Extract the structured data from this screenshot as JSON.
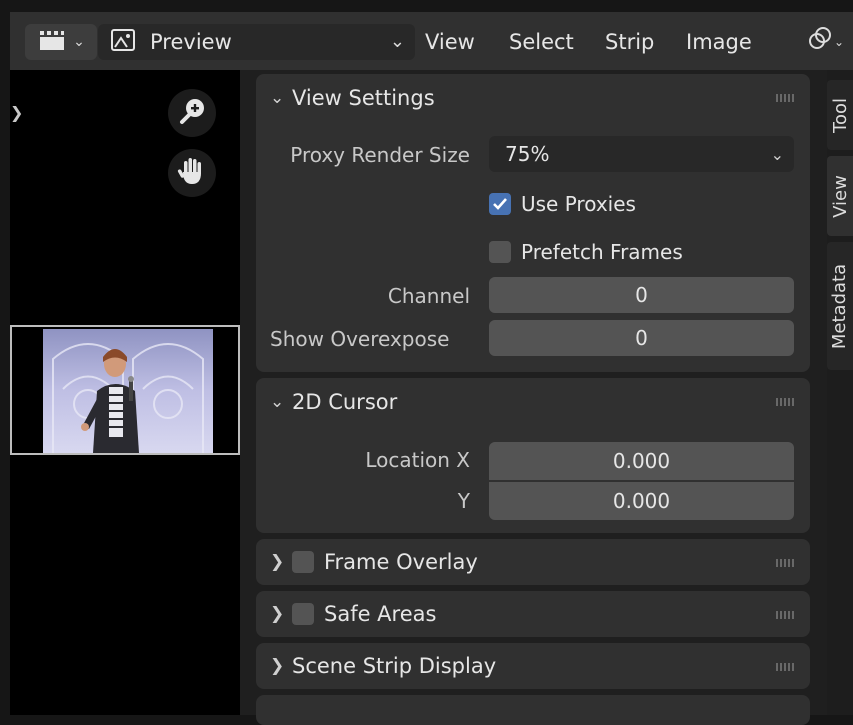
{
  "header": {
    "editor_type_icon": "sequencer-clapper-icon",
    "mode_icon": "image-preview-icon",
    "mode_label": "Preview",
    "menus": [
      "View",
      "Select",
      "Strip",
      "Image"
    ],
    "gizmo_icon": "link-icon"
  },
  "preview": {
    "zoom_icon": "zoom-in-icon",
    "pan_icon": "hand-pan-icon"
  },
  "view_settings": {
    "title": "View Settings",
    "proxy_render_size_label": "Proxy Render Size",
    "proxy_render_size_value": "75%",
    "use_proxies_label": "Use Proxies",
    "use_proxies_checked": true,
    "prefetch_frames_label": "Prefetch Frames",
    "prefetch_frames_checked": false,
    "channel_label": "Channel",
    "channel_value": "0",
    "show_overexpose_label": "Show Overexpose",
    "show_overexpose_value": "0"
  },
  "cursor_2d": {
    "title": "2D Cursor",
    "location_x_label": "Location X",
    "location_x_value": "0.000",
    "location_y_label": "Y",
    "location_y_value": "0.000"
  },
  "frame_overlay": {
    "title": "Frame Overlay",
    "enabled": false
  },
  "safe_areas": {
    "title": "Safe Areas",
    "enabled": false
  },
  "scene_strip_display": {
    "title": "Scene Strip Display"
  },
  "tabs": [
    "Tool",
    "View",
    "Metadata"
  ],
  "active_tab": "View",
  "colors": {
    "accent_checkbox": "#4772b3",
    "panel_bg": "#303030",
    "field_bg": "#545454"
  }
}
